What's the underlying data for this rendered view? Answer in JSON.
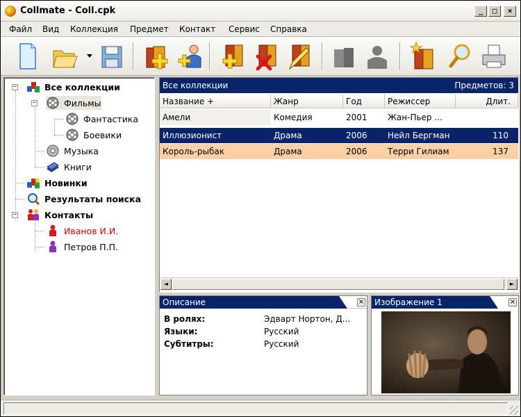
{
  "window": {
    "title": "Collmate - Coll.cpk",
    "controls": {
      "minimize": "_",
      "maximize": "□",
      "close": "×"
    }
  },
  "menu": [
    "Файл",
    "Вид",
    "Коллекция",
    "Предмет",
    "Контакт",
    "Сервис",
    "Справка"
  ],
  "toolbar": {
    "buttons": [
      "new-file-icon",
      "open-folder-icon",
      "save-icon",
      "add-collection-icon",
      "add-contact-icon",
      "add-item-icon",
      "delete-item-icon",
      "edit-item-icon",
      "disabled-item-icon",
      "disabled-contact-icon",
      "new-items-icon",
      "search-icon",
      "print-icon"
    ]
  },
  "tree": {
    "items": [
      {
        "label": "Все коллекции",
        "bold": true
      },
      {
        "label": "Фильмы",
        "bold": false,
        "selected": true
      },
      {
        "label": "Фантастика"
      },
      {
        "label": "Боевики"
      },
      {
        "label": "Музыка"
      },
      {
        "label": "Книги"
      },
      {
        "label": "Новинки",
        "bold": true
      },
      {
        "label": "Результаты поиска",
        "bold": true
      },
      {
        "label": "Контакты",
        "bold": true
      },
      {
        "label": "Иванов И.И.",
        "color": "#e00000"
      },
      {
        "label": "Петров П.П."
      }
    ],
    "expanders": [
      "−",
      "−",
      "−"
    ]
  },
  "list": {
    "caption": "Все коллекции",
    "count_label": "Предметов: 3",
    "columns": [
      "Название +",
      "Жанр",
      "Год",
      "Режиссер",
      "Длит."
    ],
    "rows": [
      {
        "title": "Амели",
        "genre": "Комедия",
        "year": "2001",
        "director": "Жан-Пьер ...",
        "duration": ""
      },
      {
        "title": "Иллюзионист",
        "genre": "Драма",
        "year": "2006",
        "director": "Нейл Бергман",
        "duration": "110"
      },
      {
        "title": "Король-рыбак",
        "genre": "Драма",
        "year": "2006",
        "director": "Терри Гилиам",
        "duration": "137"
      }
    ],
    "scroll_left": "◄",
    "scroll_right": "►"
  },
  "description": {
    "caption": "Описание",
    "close": "×",
    "props": [
      {
        "label": "В ролях:",
        "value": "Эдварт Нортон, Д..."
      },
      {
        "label": "Языки:",
        "value": "Русский"
      },
      {
        "label": "Субтитры:",
        "value": "Русский"
      }
    ]
  },
  "image_panel": {
    "caption": "Изображение 1",
    "close": "×"
  },
  "colors": {
    "selection": "#0a246a",
    "highlight_row": "#fbcfa6",
    "contact_red": "#e00000"
  }
}
